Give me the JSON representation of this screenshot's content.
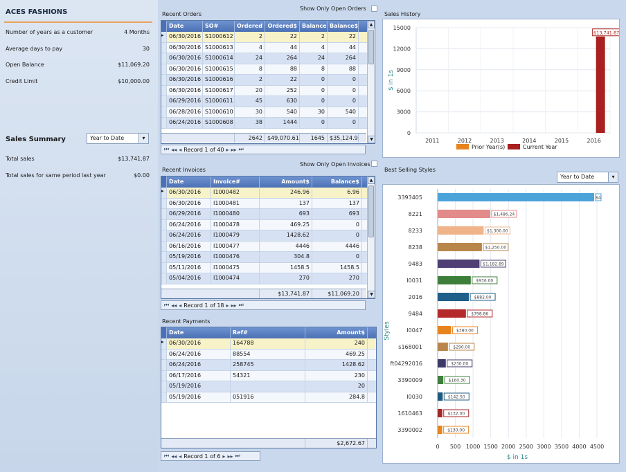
{
  "company": "ACES FASHIONS",
  "kpis": [
    {
      "label": "Number of years as a customer",
      "value": "4 Months"
    },
    {
      "label": "Average days to pay",
      "value": "30"
    },
    {
      "label": "Open Balance",
      "value": "$11,069.20"
    },
    {
      "label": "Credit Limit",
      "value": "$10,000.00"
    }
  ],
  "sales_summary": {
    "title": "Sales Summary",
    "period": "Year to Date",
    "rows": [
      {
        "label": "Total sales",
        "value": "$13,741.87"
      },
      {
        "label": "Total sales for same period last year",
        "value": "$0.00"
      }
    ]
  },
  "recent_orders": {
    "title": "Recent Orders",
    "filter_label": "Show Only Open Orders",
    "columns": [
      "Date",
      "SO#",
      "Ordered",
      "Ordered$",
      "Balance",
      "Balance$"
    ],
    "rows": [
      [
        "06/30/2016",
        "S1000612",
        "2",
        "22",
        "2",
        "22"
      ],
      [
        "06/30/2016",
        "S1000613",
        "4",
        "44",
        "4",
        "44"
      ],
      [
        "06/30/2016",
        "S1000614",
        "24",
        "264",
        "24",
        "264"
      ],
      [
        "06/30/2016",
        "S1000615",
        "8",
        "88",
        "8",
        "88"
      ],
      [
        "06/30/2016",
        "S1000616",
        "2",
        "22",
        "0",
        "0"
      ],
      [
        "06/30/2016",
        "S1000617",
        "20",
        "252",
        "0",
        "0"
      ],
      [
        "06/29/2016",
        "S1000611",
        "45",
        "630",
        "0",
        "0"
      ],
      [
        "06/28/2016",
        "S1000610",
        "30",
        "540",
        "30",
        "540"
      ],
      [
        "06/24/2016",
        "S1000608",
        "38",
        "1444",
        "0",
        "0"
      ]
    ],
    "totals": [
      "2642",
      "$49,070.61",
      "1645",
      "$35,124.90"
    ],
    "nav": "Record 1 of 40"
  },
  "recent_invoices": {
    "title": "Recent Invoices",
    "filter_label": "Show Only Open Invoices",
    "columns": [
      "Date",
      "Invoice#",
      "Amount$",
      "Balance$"
    ],
    "rows": [
      [
        "06/30/2016",
        "I1000482",
        "246.96",
        "6.96"
      ],
      [
        "06/30/2016",
        "I1000481",
        "137",
        "137"
      ],
      [
        "06/29/2016",
        "I1000480",
        "693",
        "693"
      ],
      [
        "06/24/2016",
        "I1000478",
        "469.25",
        "0"
      ],
      [
        "06/24/2016",
        "I1000479",
        "1428.62",
        "0"
      ],
      [
        "06/16/2016",
        "I1000477",
        "4446",
        "4446"
      ],
      [
        "05/19/2016",
        "I1000476",
        "304.8",
        "0"
      ],
      [
        "05/11/2016",
        "I1000475",
        "1458.5",
        "1458.5"
      ],
      [
        "05/04/2016",
        "I1000474",
        "270",
        "270"
      ]
    ],
    "totals": [
      "$13,741.87",
      "$11,069.20"
    ],
    "nav": "Record 1 of 18"
  },
  "recent_payments": {
    "title": "Recent Payments",
    "columns": [
      "Date",
      "Ref#",
      "Amount$"
    ],
    "rows": [
      [
        "06/30/2016",
        "164788",
        "240"
      ],
      [
        "06/24/2016",
        "88554",
        "469.25"
      ],
      [
        "06/24/2016",
        "258745",
        "1428.62"
      ],
      [
        "06/17/2016",
        "54321",
        "230"
      ],
      [
        "05/19/2016",
        "",
        "20"
      ],
      [
        "05/19/2016",
        "051916",
        "284.8"
      ]
    ],
    "total": "$2,672.67",
    "nav": "Record 1 of 6"
  },
  "sales_history": {
    "title": "Sales History"
  },
  "best_selling": {
    "title": "Best Selling Styles",
    "period": "Year to Date"
  },
  "colors": {
    "prior": "#e8841e",
    "current": "#a8201f",
    "header": "#4f74b9"
  },
  "chart_data": [
    {
      "type": "bar",
      "title": "",
      "categories": [
        "2011",
        "2012",
        "2013",
        "2014",
        "2015",
        "2016"
      ],
      "series": [
        {
          "name": "Prior Year(s)",
          "values": [
            0,
            0,
            0,
            0,
            0,
            0
          ]
        },
        {
          "name": "Current Year",
          "values": [
            0,
            0,
            0,
            0,
            0,
            13741.87
          ]
        }
      ],
      "data_labels": [
        "$13,741.87"
      ],
      "ylabel": "$ in 1s",
      "yticks": [
        "0",
        "3000",
        "6000",
        "9000",
        "12000",
        "15000"
      ],
      "ylim": [
        0,
        15000
      ],
      "legend": "bottom"
    },
    {
      "type": "bar",
      "orientation": "horizontal",
      "categories": [
        "3393405",
        "8221",
        "8233",
        "8238",
        "9483",
        "I0031",
        "2016",
        "9484",
        "I0047",
        "s168001",
        "ft04292016",
        "3390009",
        "I0030",
        "1610463",
        "3390002"
      ],
      "values": [
        4600,
        1486.24,
        1300,
        1250,
        1182.89,
        936,
        882,
        798.86,
        380,
        290,
        230,
        160.3,
        142.5,
        132,
        130
      ],
      "data_labels": [
        "$4...",
        "$1,486.24",
        "$1,300.00",
        "$1,250.00",
        "$1,182.89",
        "$936.00",
        "$882.00",
        "$798.86",
        "$380.00",
        "$290.00",
        "$230.00",
        "$160.30",
        "$142.50",
        "$132.00",
        "$130.00"
      ],
      "colors": [
        "#4aa3d9",
        "#e38a8a",
        "#f0b48a",
        "#b8864a",
        "#4e3f74",
        "#3d7f3a",
        "#1f5f8a",
        "#b42a2a",
        "#e8841e",
        "#b8864a",
        "#3d3a6a",
        "#3f7f3c",
        "#1f5a7e",
        "#a52626",
        "#e8841e"
      ],
      "xlabel": "$ in 1s",
      "ylabel": "Styles",
      "xticks": [
        "0",
        "500",
        "1000",
        "1500",
        "2000",
        "2500",
        "3000",
        "3500",
        "4000",
        "4500"
      ],
      "xlim": [
        0,
        4500
      ]
    }
  ]
}
